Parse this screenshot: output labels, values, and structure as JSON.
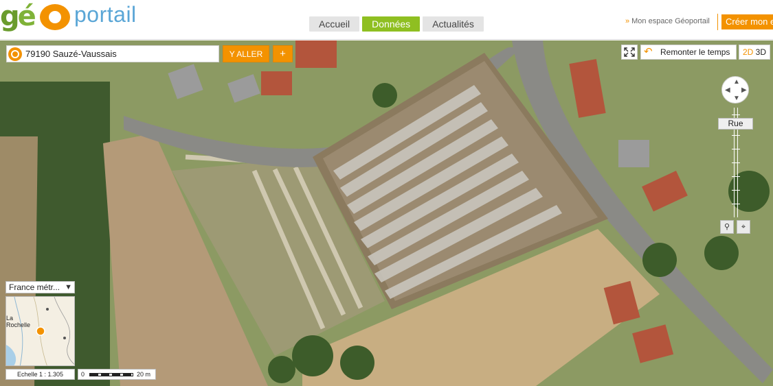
{
  "header": {
    "logo_geo": "géO",
    "logo_portail": "portail",
    "nav": [
      {
        "label": "Accueil",
        "active": false
      },
      {
        "label": "Données",
        "active": true
      },
      {
        "label": "Actualités",
        "active": false
      }
    ],
    "espace_label": "Mon espace Géoportail",
    "creer_label": "Créer mon e"
  },
  "search": {
    "value": "79190 Sauzé-Vaussais",
    "go_label": "Y ALLER",
    "plus_label": "+"
  },
  "toolbar": {
    "remonter_label": "Remonter le temps",
    "mode_2d": "2D",
    "mode_3d": "3D"
  },
  "navigation": {
    "zoom_level_label": "Rue",
    "zoom_in_icon": "magnifier-icon",
    "center_icon": "crosshair-icon"
  },
  "overview": {
    "territory": "France métr...",
    "place_label_1": "La",
    "place_label_2": "Rochelle",
    "scale_label": "Echelle 1 :  1.305",
    "scale_zero": "0",
    "scale_distance": "20 m"
  },
  "colors": {
    "brand_orange": "#f39200",
    "brand_green": "#8fbf21",
    "brand_blue": "#5aa6d6"
  }
}
